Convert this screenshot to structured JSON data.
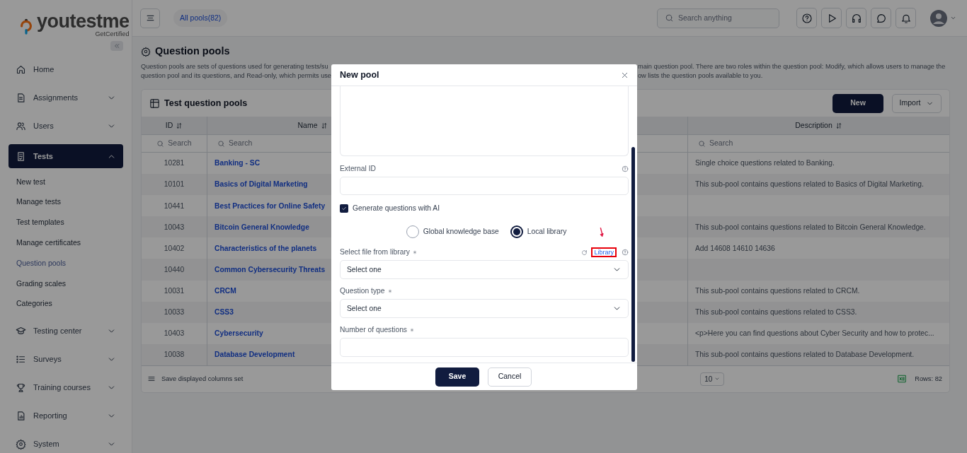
{
  "logo": {
    "name": "youtestme",
    "tagline": "GetCertified"
  },
  "sidebar": {
    "items": [
      {
        "label": "Home",
        "kind": "link",
        "selected": false
      },
      {
        "label": "Assignments",
        "kind": "section",
        "expanded": false,
        "selected": false
      },
      {
        "label": "Users",
        "kind": "section",
        "expanded": false,
        "selected": false
      },
      {
        "label": "Tests",
        "kind": "section",
        "expanded": true,
        "selected": true,
        "children": [
          {
            "label": "New test",
            "selected": false
          },
          {
            "label": "Manage tests",
            "selected": false
          },
          {
            "label": "Test templates",
            "selected": false
          },
          {
            "label": "Manage certificates",
            "selected": false
          },
          {
            "label": "Question pools",
            "selected": true
          },
          {
            "label": "Grading scales",
            "selected": false
          },
          {
            "label": "Categories",
            "selected": false
          }
        ]
      },
      {
        "label": "Testing center",
        "kind": "section",
        "expanded": false,
        "selected": false
      },
      {
        "label": "Surveys",
        "kind": "section",
        "expanded": false,
        "selected": false
      },
      {
        "label": "Training courses",
        "kind": "section",
        "expanded": false,
        "selected": false
      },
      {
        "label": "Reporting",
        "kind": "section",
        "expanded": false,
        "selected": false
      },
      {
        "label": "System",
        "kind": "section",
        "expanded": false,
        "selected": false
      }
    ]
  },
  "topbar": {
    "filter_chip": "All pools(82)",
    "search": {
      "placeholder": "Search anything"
    }
  },
  "page": {
    "title": "Question pools",
    "description_left": [
      "Question pools are sets of questions used for generating tests/su",
      "question pool and its questions, and Read-only, which permits use"
    ],
    "description_right": [
      "main question pool. There are two roles within the question pool: Modify, which allows users to manage the",
      "ow lists the question pools available to you."
    ]
  },
  "table": {
    "title": "Test question pools",
    "buttons": [
      "New",
      "Import"
    ],
    "columns": [
      {
        "label": "ID",
        "placeholder": "Search"
      },
      {
        "label": "Name",
        "placeholder": "Search"
      },
      {
        "label": "Description",
        "placeholder": "Search"
      }
    ],
    "rows": [
      {
        "id": "10281",
        "name": "Banking - SC",
        "description": "Single choice questions related to Banking."
      },
      {
        "id": "10101",
        "name": "Basics of Digital Marketing",
        "description": "This sub-pool contains questions related to Basics of Digital Marketing."
      },
      {
        "id": "10441",
        "name": "Best Practices for Online Safety"
      },
      {
        "id": "10043",
        "name": "Bitcoin General Knowledge",
        "description": "This sub-pool contains questions related to Bitcoin General Knowledge."
      },
      {
        "id": "10402",
        "name": "Characteristics of the planets",
        "description": "Add 14608 14610 14636"
      },
      {
        "id": "10440",
        "name": "Common Cybersecurity Threats"
      },
      {
        "id": "10031",
        "name": "CRCM",
        "description": "This sub-pool contains questions related to CRCM."
      },
      {
        "id": "10033",
        "name": "CSS3",
        "description": "This sub-pool contains questions related to CSS3."
      },
      {
        "id": "10403",
        "name": "Cybersecurity",
        "description": "<p>Here you can find questions about Cyber Security and how to protec..."
      },
      {
        "id": "10038",
        "name": "Database Development",
        "description": "This sub-pool contains questions related to Database Development."
      }
    ],
    "footer": {
      "save_columns": "Save displayed columns set",
      "page_size": "10",
      "rows_count": "Rows: 82"
    }
  },
  "dialog": {
    "title": "New pool",
    "external_id": {
      "label": "External ID"
    },
    "generate_ai": {
      "label": "Generate questions with AI",
      "checked": true
    },
    "sources": [
      {
        "label": "Global knowledge base",
        "selected": false
      },
      {
        "label": "Local library",
        "selected": true
      }
    ],
    "file_select": {
      "label": "Select file from library",
      "required": true,
      "value": "Select one",
      "library_link": {
        "label": "Library",
        "highlighted": true
      }
    },
    "question_type": {
      "label": "Question type",
      "required": true,
      "value": "Select one"
    },
    "number_of_questions": {
      "label": "Number of questions",
      "required": true
    },
    "buttons": [
      "Save",
      "Cancel"
    ]
  }
}
